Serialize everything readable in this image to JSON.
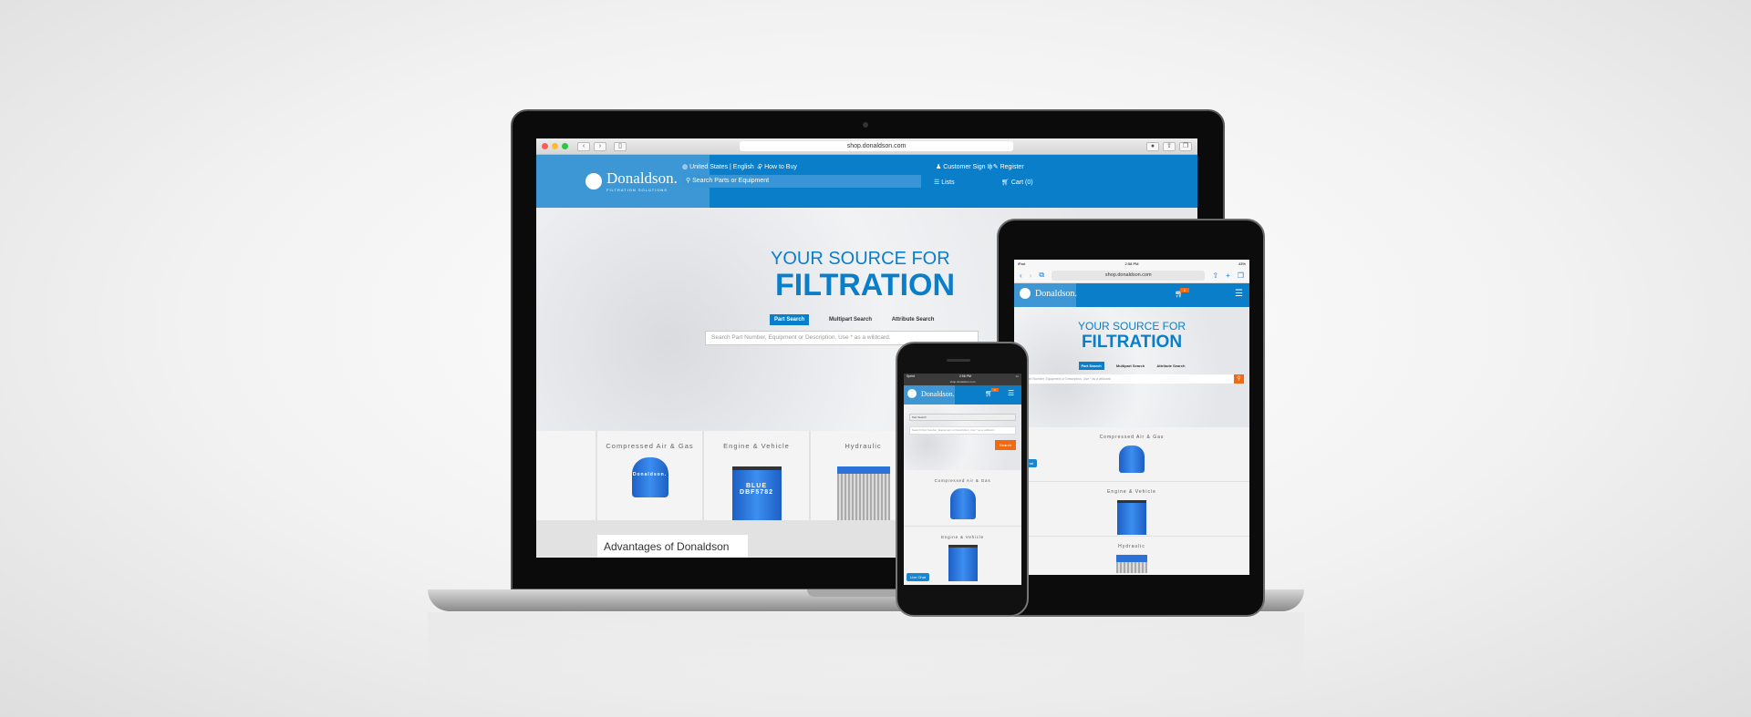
{
  "site": {
    "url": "shop.donaldson.com",
    "brand": "Donaldson.",
    "brand_sub": "FILTRATION SOLUTIONS",
    "locale": "United States | English",
    "how_to_buy": "How to Buy",
    "sign_in": "Customer Sign In",
    "register": "Register",
    "header_search_placeholder": "Search Parts or Equipment",
    "lists": "Lists",
    "cart": "Cart (0)",
    "cart_badge": "0",
    "hero_line1": "YOUR SOURCE FOR",
    "hero_line2": "FILTRATION",
    "tabs": [
      "Part Search",
      "Multipart Search",
      "Attribute Search"
    ],
    "search_placeholder": "Search Part Number, Equipment or Description. Use * as a wildcard.",
    "search_button": "Search",
    "select_value": "Part Search",
    "categories": [
      "Compressed Air & Gas",
      "Engine & Vehicle",
      "Hydraulic"
    ],
    "product_label": "DBF5782",
    "product_brand": "BLUE",
    "advantages": "Advantages of Donaldson",
    "live_chat": "Live Chat"
  },
  "status": {
    "time": "2:56 PM",
    "carrier": "Sprint",
    "tablet_label": "iPad",
    "tablet_time": "2:58 PM",
    "battery": "43%"
  },
  "colors": {
    "brand_blue": "#0a7ec8",
    "accent_orange": "#f26a10"
  }
}
